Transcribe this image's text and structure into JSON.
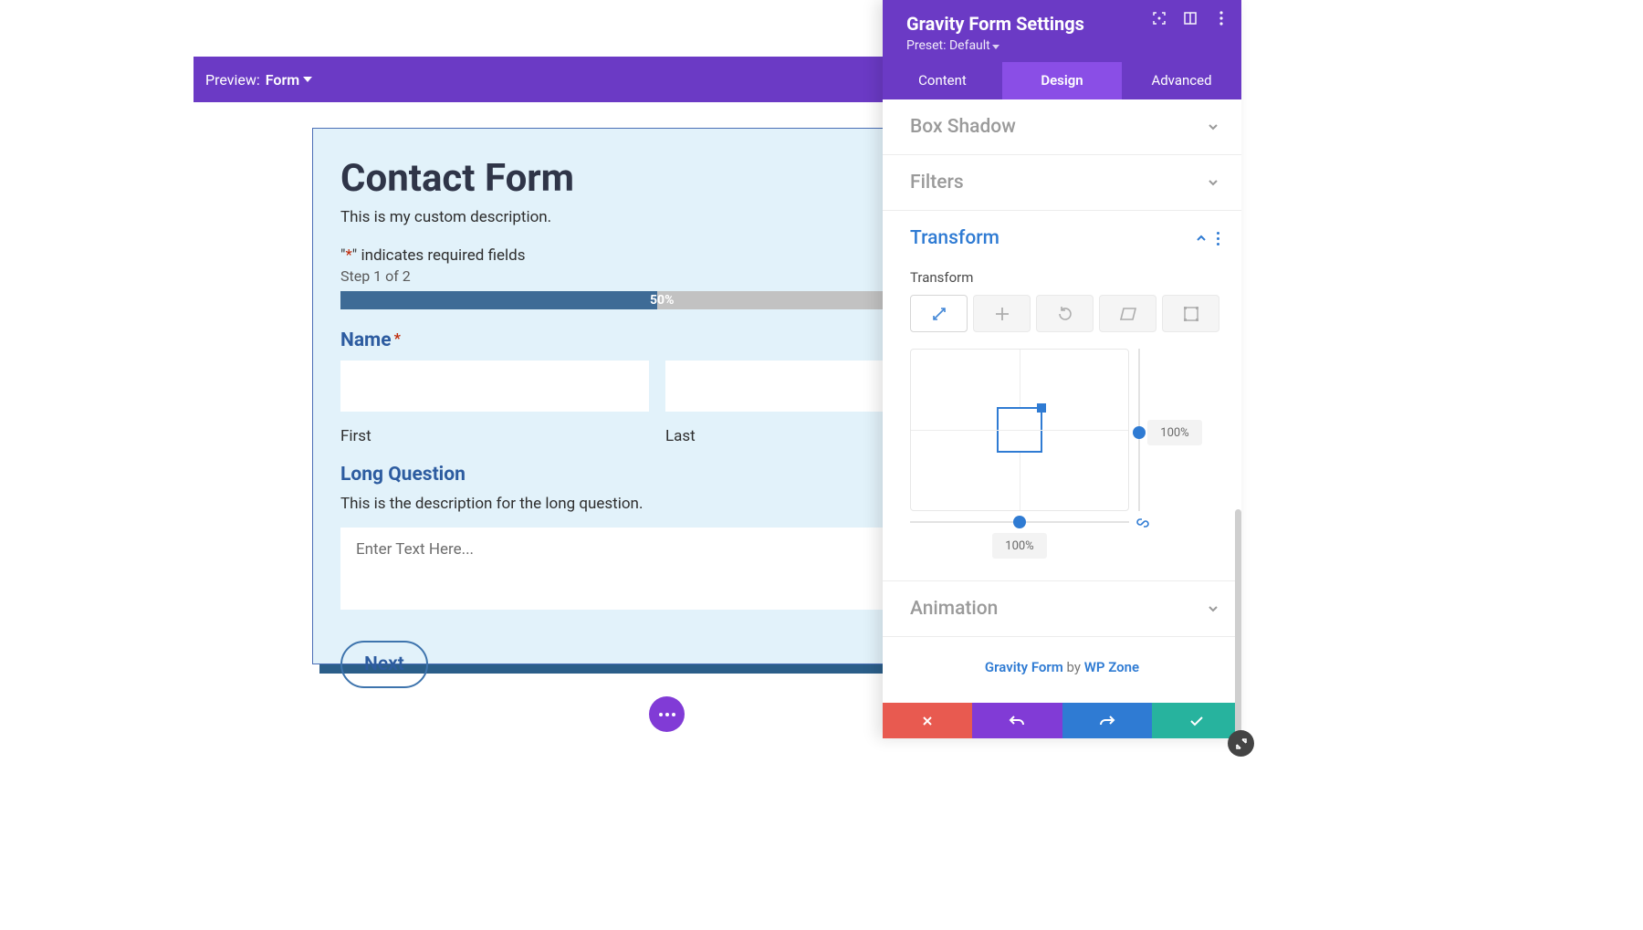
{
  "preview": {
    "label": "Preview:",
    "value": "Form"
  },
  "form": {
    "title": "Contact Form",
    "description": "This is my custom description.",
    "required_note_prefix": "\"",
    "required_note_star": "*",
    "required_note_suffix": "\" indicates required fields",
    "step_text": "Step 1 of 2",
    "progress_pct": "50%",
    "name": {
      "label": "Name",
      "first_label": "First",
      "last_label": "Last"
    },
    "long": {
      "label": "Long Question",
      "description": "This is the description for the long question.",
      "placeholder": "Enter Text Here..."
    },
    "next_label": "Next"
  },
  "settings": {
    "title": "Gravity Form Settings",
    "preset_text": "Preset: Default",
    "tabs": {
      "content": "Content",
      "design": "Design",
      "advanced": "Advanced"
    },
    "sections": {
      "box_shadow": "Box Shadow",
      "filters": "Filters",
      "transform": "Transform",
      "animation": "Animation"
    },
    "transform": {
      "sublabel": "Transform",
      "v_value": "100%",
      "h_value": "100%"
    },
    "credit": {
      "link1": "Gravity Form",
      "by": " by ",
      "link2": "WP Zone"
    }
  }
}
